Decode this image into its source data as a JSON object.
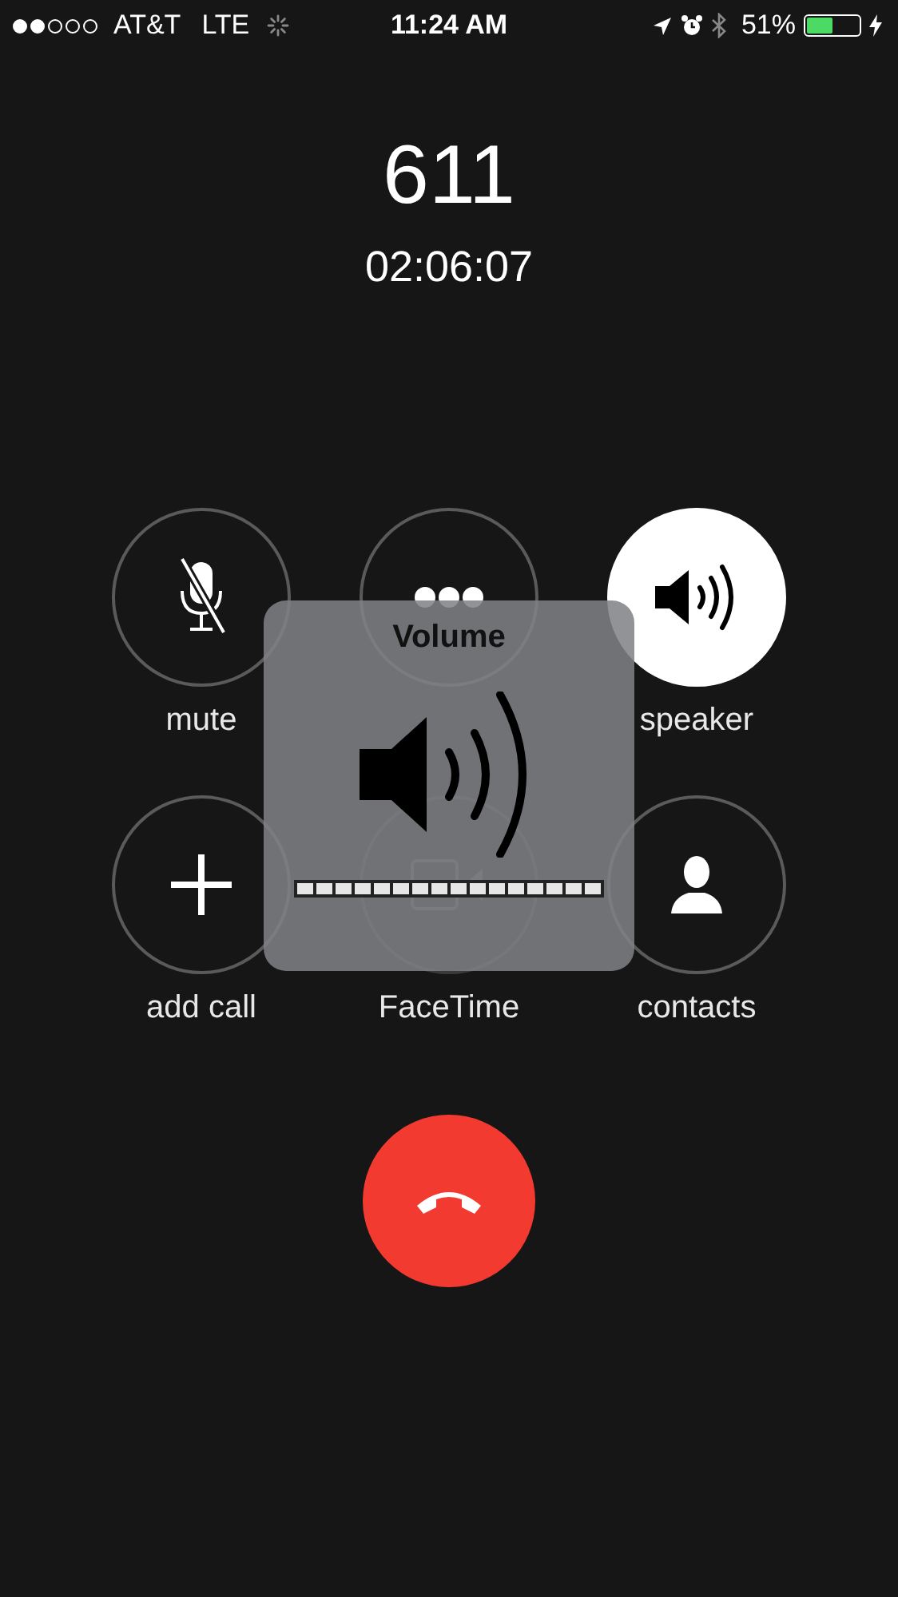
{
  "status_bar": {
    "signal_bars": [
      {
        "on": true
      },
      {
        "on": true
      },
      {
        "on": false
      },
      {
        "on": false
      },
      {
        "on": false
      }
    ],
    "carrier": "AT&T",
    "network": "LTE",
    "time": "11:24 AM",
    "battery_percent": "51%",
    "battery": {
      "level": 0.51
    },
    "charging": true
  },
  "call": {
    "number": "611",
    "duration": "02:06:07"
  },
  "buttons": [
    {
      "kind": "mute",
      "label": "mute",
      "selected": false,
      "disabled": false
    },
    {
      "kind": "keypad",
      "selected": false,
      "disabled": false
    },
    {
      "kind": "speaker",
      "label": "speaker",
      "selected": true,
      "disabled": false
    },
    {
      "kind": "add",
      "label": "add call",
      "selected": false,
      "disabled": false
    },
    {
      "kind": "facetime",
      "label": "FaceTime",
      "selected": false,
      "disabled": true
    },
    {
      "kind": "contacts",
      "label": "contacts",
      "selected": false,
      "disabled": false
    }
  ],
  "volume_hud": {
    "title": "Volume"
  }
}
